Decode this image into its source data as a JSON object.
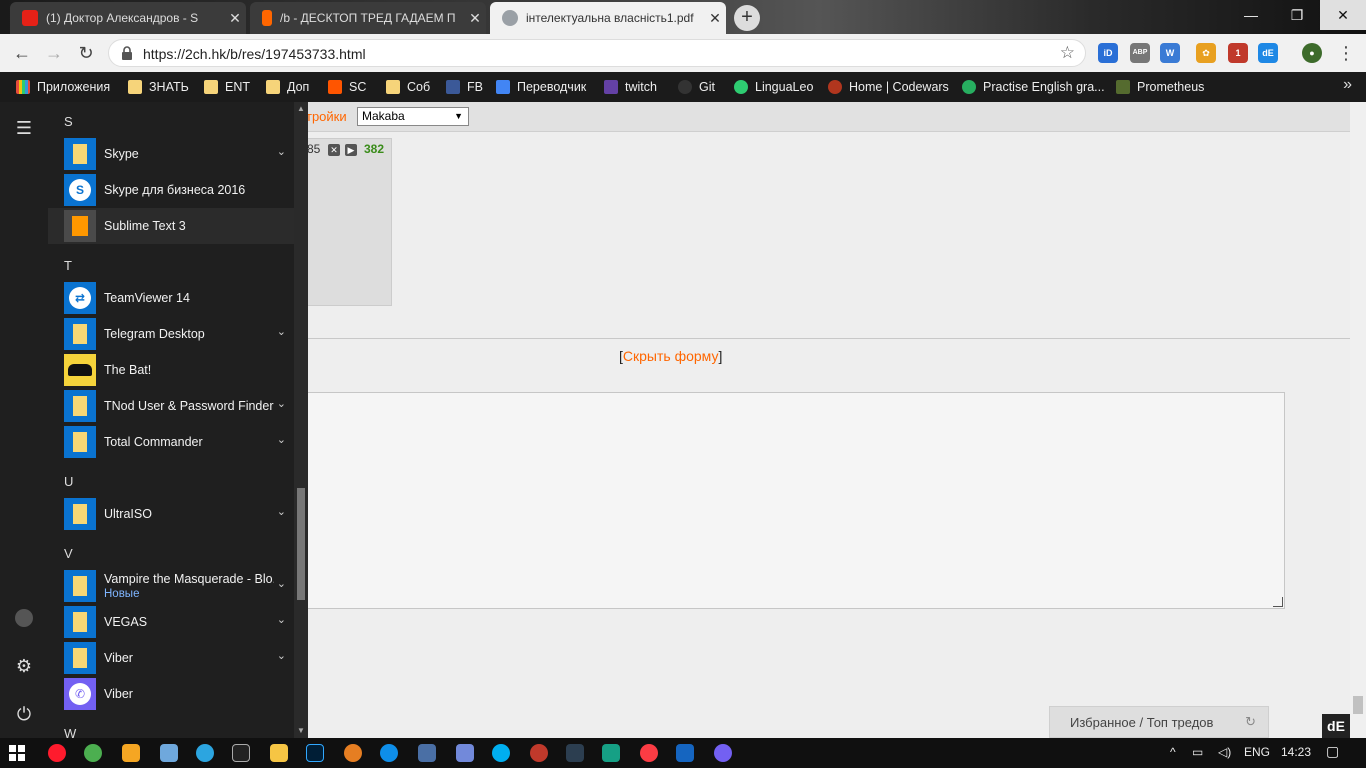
{
  "tabs": [
    {
      "title": "(1) Доктор Александров - S",
      "icon": "youtube-icon",
      "color": "#e62117"
    },
    {
      "title": "/b - ДЕСКТОП ТРЕД ГАДАЕМ П",
      "icon": "lightning-icon",
      "color": "#ff6600"
    },
    {
      "title": "інтелектуальна власність1.pdf",
      "icon": "globe-icon",
      "color": "#ffffff"
    }
  ],
  "window_controls": {
    "minimize": "—",
    "maximize": "❐",
    "close": "✕"
  },
  "address": {
    "url": "https://2ch.hk/b/res/197453733.html"
  },
  "extensions": [
    {
      "label": "iD",
      "color": "#2a6fd6"
    },
    {
      "label": "ABP",
      "color": "#777777"
    },
    {
      "label": "W",
      "color": "#3a7bd5"
    },
    {
      "label": "✿",
      "color": "#e8a020"
    },
    {
      "label": "1",
      "color": "#c0392b"
    },
    {
      "label": "dE",
      "color": "#1e88e5"
    },
    {
      "label": "●",
      "color": "#3d6b2b"
    }
  ],
  "bookmarks": [
    {
      "label": "Приложения",
      "icon": "apps-grid-icon"
    },
    {
      "label": "ЗНАТЬ",
      "icon": "folder-icon"
    },
    {
      "label": "ENT",
      "icon": "folder-icon"
    },
    {
      "label": "Доп",
      "icon": "folder-icon"
    },
    {
      "label": "SC",
      "icon": "soundcloud-icon"
    },
    {
      "label": "Соб",
      "icon": "folder-icon"
    },
    {
      "label": "FB",
      "icon": "facebook-icon"
    },
    {
      "label": "Переводчик",
      "icon": "translate-icon"
    },
    {
      "label": "twitch",
      "icon": "twitch-icon"
    },
    {
      "label": "Git",
      "icon": "github-icon"
    },
    {
      "label": "LinguaLeo",
      "icon": "lingualeo-icon"
    },
    {
      "label": "Home | Codewars",
      "icon": "codewars-icon"
    },
    {
      "label": "Practise English gra...",
      "icon": "clover-icon"
    },
    {
      "label": "Prometheus",
      "icon": "prometheus-icon"
    }
  ],
  "page": {
    "settings_label": "тройки",
    "style_select": "Makaba",
    "post_number": "85",
    "post_count": "382",
    "hide_form_open": "[",
    "hide_form_link": "Скрыть форму",
    "hide_form_close": "]",
    "favorites": "Избранное",
    "favorites_sep": "/",
    "top_threads": "Топ тредов",
    "badge": "dE"
  },
  "start_menu": {
    "letters": {
      "s": "S",
      "t": "T",
      "u": "U",
      "v": "V",
      "w": "W"
    },
    "apps": [
      {
        "name": "Skype",
        "icon": "folder-icon",
        "expand": true
      },
      {
        "name": "Skype для бизнеса 2016",
        "icon": "skype-icon",
        "expand": false
      },
      {
        "name": "Sublime Text 3",
        "icon": "sublime-icon",
        "expand": false
      },
      {
        "name": "TeamViewer 14",
        "icon": "teamviewer-icon",
        "expand": false
      },
      {
        "name": "Telegram Desktop",
        "icon": "folder-icon",
        "expand": true
      },
      {
        "name": "The Bat!",
        "icon": "bat-icon",
        "expand": false
      },
      {
        "name": "TNod User & Password Finder",
        "icon": "folder-icon",
        "expand": true
      },
      {
        "name": "Total Commander",
        "icon": "folder-icon",
        "expand": true
      },
      {
        "name": "UltraISO",
        "icon": "folder-icon",
        "expand": true
      },
      {
        "name": "Vampire the Masquerade - Blo...",
        "sub": "Новые",
        "icon": "folder-icon",
        "expand": true
      },
      {
        "name": "VEGAS",
        "icon": "folder-icon",
        "expand": true
      },
      {
        "name": "Viber",
        "icon": "folder-icon",
        "expand": true
      },
      {
        "name": "Viber",
        "icon": "viber-icon",
        "expand": false
      }
    ]
  },
  "taskbar": {
    "language": "ENG",
    "time": "14:23"
  }
}
